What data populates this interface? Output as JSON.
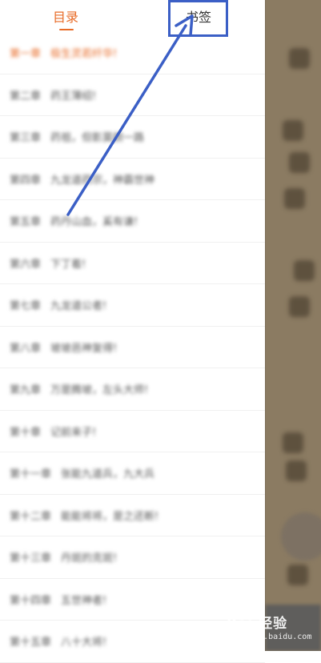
{
  "tabs": {
    "toc_label": "目录",
    "bookmark_label": "书签"
  },
  "chapters": [
    {
      "number": "第一章",
      "title": "极生灵若纤华!",
      "current": true
    },
    {
      "number": "第二章",
      "title": "药王薄绍!"
    },
    {
      "number": "第三章",
      "title": "药祖，但影莫颜一路"
    },
    {
      "number": "第四章",
      "title": "九龙道药宗，神霸世神"
    },
    {
      "number": "第五章",
      "title": "药丹山血，奚有谦!"
    },
    {
      "number": "第六章",
      "title": "下丁着!"
    },
    {
      "number": "第七章",
      "title": "九龙道公者!"
    },
    {
      "number": "第八章",
      "title": "坡坡邑神复得!"
    },
    {
      "number": "第九章",
      "title": "万是腾坡，左头大师!"
    },
    {
      "number": "第十章",
      "title": "记前来子!"
    },
    {
      "number": "第十一章",
      "title": "张能九道兵，九大兵"
    },
    {
      "number": "第十二章",
      "title": "能能将将，是之还断!"
    },
    {
      "number": "第十三章",
      "title": "丹斑的克斑!"
    },
    {
      "number": "第十四章",
      "title": "五世神者!"
    },
    {
      "number": "第十五章",
      "title": "八十大将!"
    }
  ],
  "watermark": {
    "logo": "Bai 经验",
    "url": "jingyan.baidu.com"
  },
  "colors": {
    "accent": "#e86b27",
    "annotation": "#3b5fc6",
    "reader_bg": "#8b7b62"
  }
}
